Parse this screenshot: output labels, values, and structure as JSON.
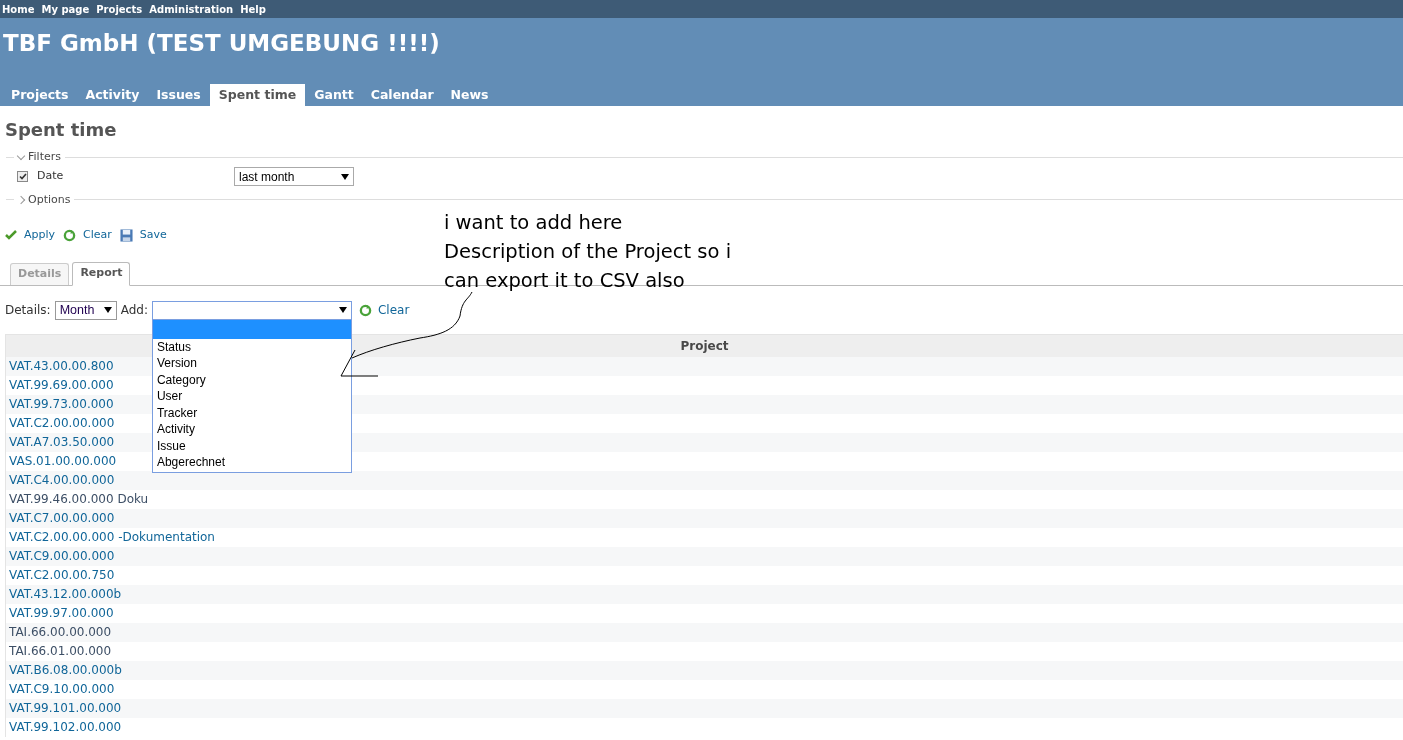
{
  "top_menu": [
    "Home",
    "My page",
    "Projects",
    "Administration",
    "Help"
  ],
  "header": {
    "title": "TBF GmbH (TEST UMGEBUNG !!!!)"
  },
  "main_tabs": [
    {
      "label": "Projects",
      "selected": false
    },
    {
      "label": "Activity",
      "selected": false
    },
    {
      "label": "Issues",
      "selected": false
    },
    {
      "label": "Spent time",
      "selected": true
    },
    {
      "label": "Gantt",
      "selected": false
    },
    {
      "label": "Calendar",
      "selected": false
    },
    {
      "label": "News",
      "selected": false
    }
  ],
  "page_title": "Spent time",
  "filters": {
    "legend": "Filters",
    "expanded": true,
    "rows": [
      {
        "label": "Date",
        "checked": true,
        "value": "last month"
      }
    ]
  },
  "options": {
    "legend": "Options",
    "expanded": false
  },
  "actions": [
    {
      "kind": "apply",
      "label": "Apply"
    },
    {
      "kind": "clear",
      "label": "Clear"
    },
    {
      "kind": "save",
      "label": "Save"
    }
  ],
  "view_tabs": [
    {
      "label": "Details",
      "selected": false
    },
    {
      "label": "Report",
      "selected": true
    }
  ],
  "report_controls": {
    "details_label": "Details:",
    "details_value": "Month",
    "add_label": "Add:",
    "clear_label": "Clear"
  },
  "add_dropdown": {
    "options": [
      {
        "selected": true
      },
      {
        "label": "Status",
        "selected": false
      },
      {
        "label": "Version",
        "selected": false
      },
      {
        "label": "Category",
        "selected": false
      },
      {
        "label": "User",
        "selected": false
      },
      {
        "label": "Tracker",
        "selected": false
      },
      {
        "label": "Activity",
        "selected": false
      },
      {
        "label": "Issue",
        "selected": false
      },
      {
        "label": "Abgerechnet",
        "selected": false
      }
    ]
  },
  "table": {
    "columns": [
      "Project"
    ],
    "rows": [
      {
        "project": "VAT.43.00.00.800",
        "archived": false
      },
      {
        "project": "VAT.99.69.00.000",
        "archived": false
      },
      {
        "project": "VAT.99.73.00.000",
        "archived": false
      },
      {
        "project": "VAT.C2.00.00.000",
        "archived": false
      },
      {
        "project": "VAT.A7.03.50.000",
        "archived": false
      },
      {
        "project": "VAS.01.00.00.000",
        "archived": false
      },
      {
        "project": "VAT.C4.00.00.000",
        "archived": false
      },
      {
        "project": "VAT.99.46.00.000 Doku",
        "archived": true
      },
      {
        "project": "VAT.C7.00.00.000",
        "archived": false
      },
      {
        "project": "VAT.C2.00.00.000 -Dokumentation",
        "archived": false
      },
      {
        "project": "VAT.C9.00.00.000",
        "archived": false
      },
      {
        "project": "VAT.C2.00.00.750",
        "archived": false
      },
      {
        "project": "VAT.43.12.00.000b",
        "archived": false
      },
      {
        "project": "VAT.99.97.00.000",
        "archived": false
      },
      {
        "project": "TAI.66.00.00.000",
        "archived": true
      },
      {
        "project": "TAI.66.01.00.000",
        "archived": true
      },
      {
        "project": "VAT.B6.08.00.000b",
        "archived": false
      },
      {
        "project": "VAT.C9.10.00.000",
        "archived": false
      },
      {
        "project": "VAT.99.101.00.000",
        "archived": false
      },
      {
        "project": "VAT.99.102.00.000",
        "archived": false
      }
    ]
  },
  "annotation": {
    "lines": [
      "i want to add here",
      "Description of the Project so i",
      "can export it to CSV also"
    ]
  }
}
